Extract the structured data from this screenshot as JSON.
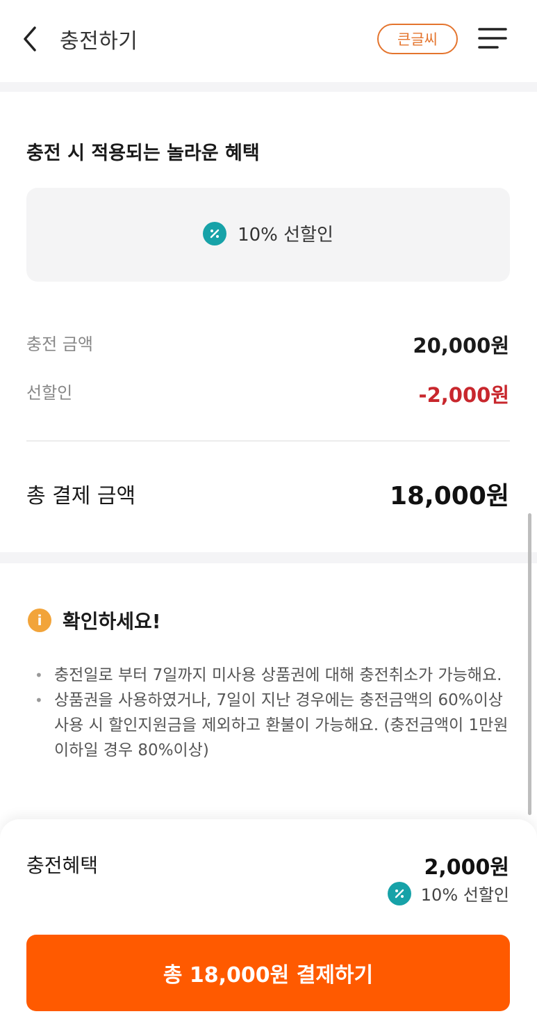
{
  "header": {
    "title": "충전하기",
    "big_font_label": "큰글씨"
  },
  "benefits": {
    "section_title": "충전 시 적용되는 놀라운 혜택",
    "discount_label": "10% 선할인"
  },
  "summary": {
    "charge_amount_label": "충전 금액",
    "charge_amount_value": "20,000원",
    "discount_label": "선할인",
    "discount_value": "-2,000원",
    "total_label": "총 결제 금액",
    "total_value": "18,000원"
  },
  "notice": {
    "title": "확인하세요!",
    "info_icon_glyph": "i",
    "items": [
      "충전일로 부터 7일까지 미사용 상품권에 대해 충전취소가 가능해요.",
      "상품권을 사용하였거나, 7일이 지난 경우에는 충전금액의 60%이상 사용 시 할인지원금을 제외하고 환불이 가능해요. (충전금액이 1만원 이하일 경우 80%이상)"
    ]
  },
  "bottom_sheet": {
    "benefit_label": "충전혜택",
    "benefit_value": "2,000원",
    "benefit_sub": "10% 선할인",
    "pay_button_label": "총 18,000원 결제하기"
  },
  "colors": {
    "accent_orange": "#ff5a00",
    "big_font_border": "#e4742d",
    "discount_red": "#c8272d",
    "teal_icon": "#17a2a8",
    "info_icon": "#f2a43a"
  },
  "icons": {
    "back": "chevron-left-icon",
    "menu": "hamburger-menu-icon",
    "percent": "percent-icon",
    "info": "info-icon"
  }
}
